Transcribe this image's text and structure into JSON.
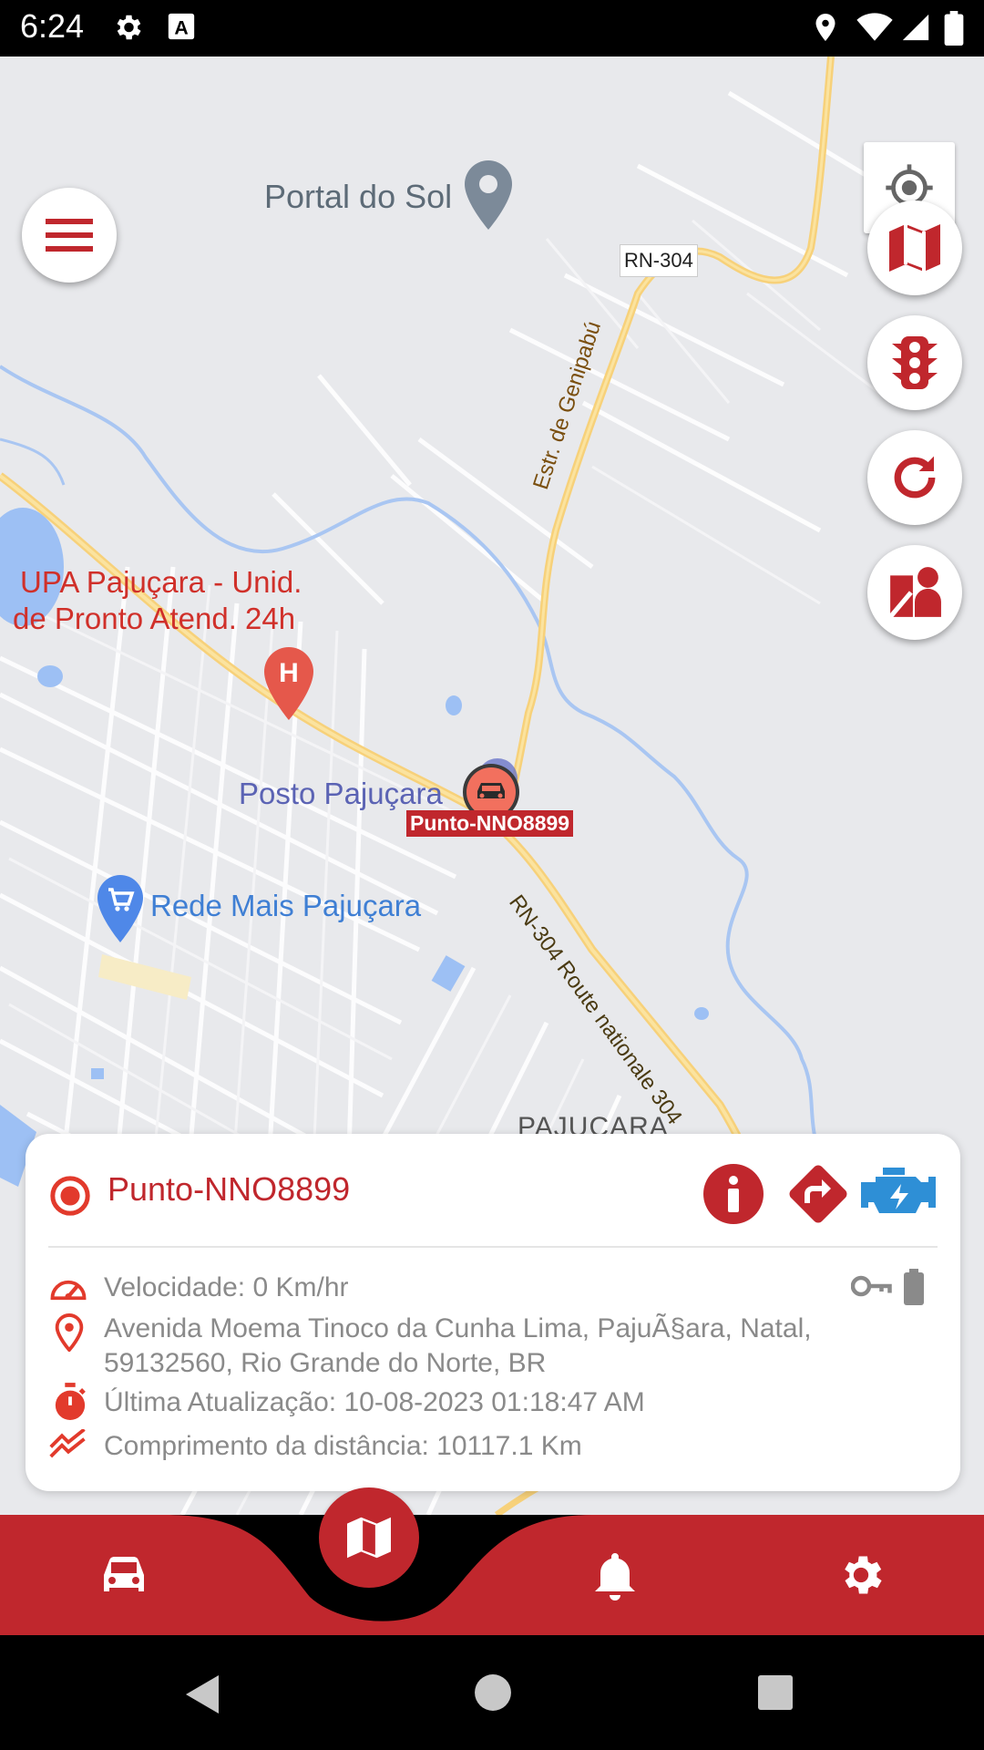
{
  "status_bar": {
    "time": "6:24"
  },
  "map": {
    "labels": {
      "portal_do_sol": "Portal do Sol",
      "rn304_shield": "RN-304",
      "estr_genipabu": "Estr. de Genipabú",
      "upa_line1": "UPA Pajuçara - Unid.",
      "upa_line2": "de Pronto Atend. 24h",
      "posto": "Posto Pajuçara",
      "rede_mais": "Rede Mais Pajuçara",
      "route_304": "RN-304 Route nationale 304",
      "pajucara": "PAJUÇARA"
    },
    "vehicle_marker_label": "Punto-NNO8899"
  },
  "map_controls": {
    "menu_icon": "menu-icon",
    "locate_icon": "crosshair-icon",
    "map_type_icon": "map-icon",
    "traffic_icon": "traffic-light-icon",
    "refresh_icon": "refresh-icon",
    "street_view_icon": "street-view-icon"
  },
  "vehicle_card": {
    "name": "Punto-NNO8899",
    "speed": "Velocidade: 0 Km/hr",
    "address_line1": "Avenida Moema Tinoco da Cunha Lima, PajuÃ§ara, Natal,",
    "address_line2": "59132560, Rio Grande do Norte, BR",
    "last_update": "Última Atualização: 10-08-2023 01:18:47 AM",
    "distance": "Comprimento da distância: 10117.1 Km"
  },
  "colors": {
    "brand_red": "#c0272d",
    "engine_blue": "#2e8fd6",
    "map_bg": "#e8e9ec"
  },
  "bottom_nav": {
    "items": [
      "car-icon",
      "map-icon",
      "bell-icon",
      "gear-icon"
    ]
  }
}
